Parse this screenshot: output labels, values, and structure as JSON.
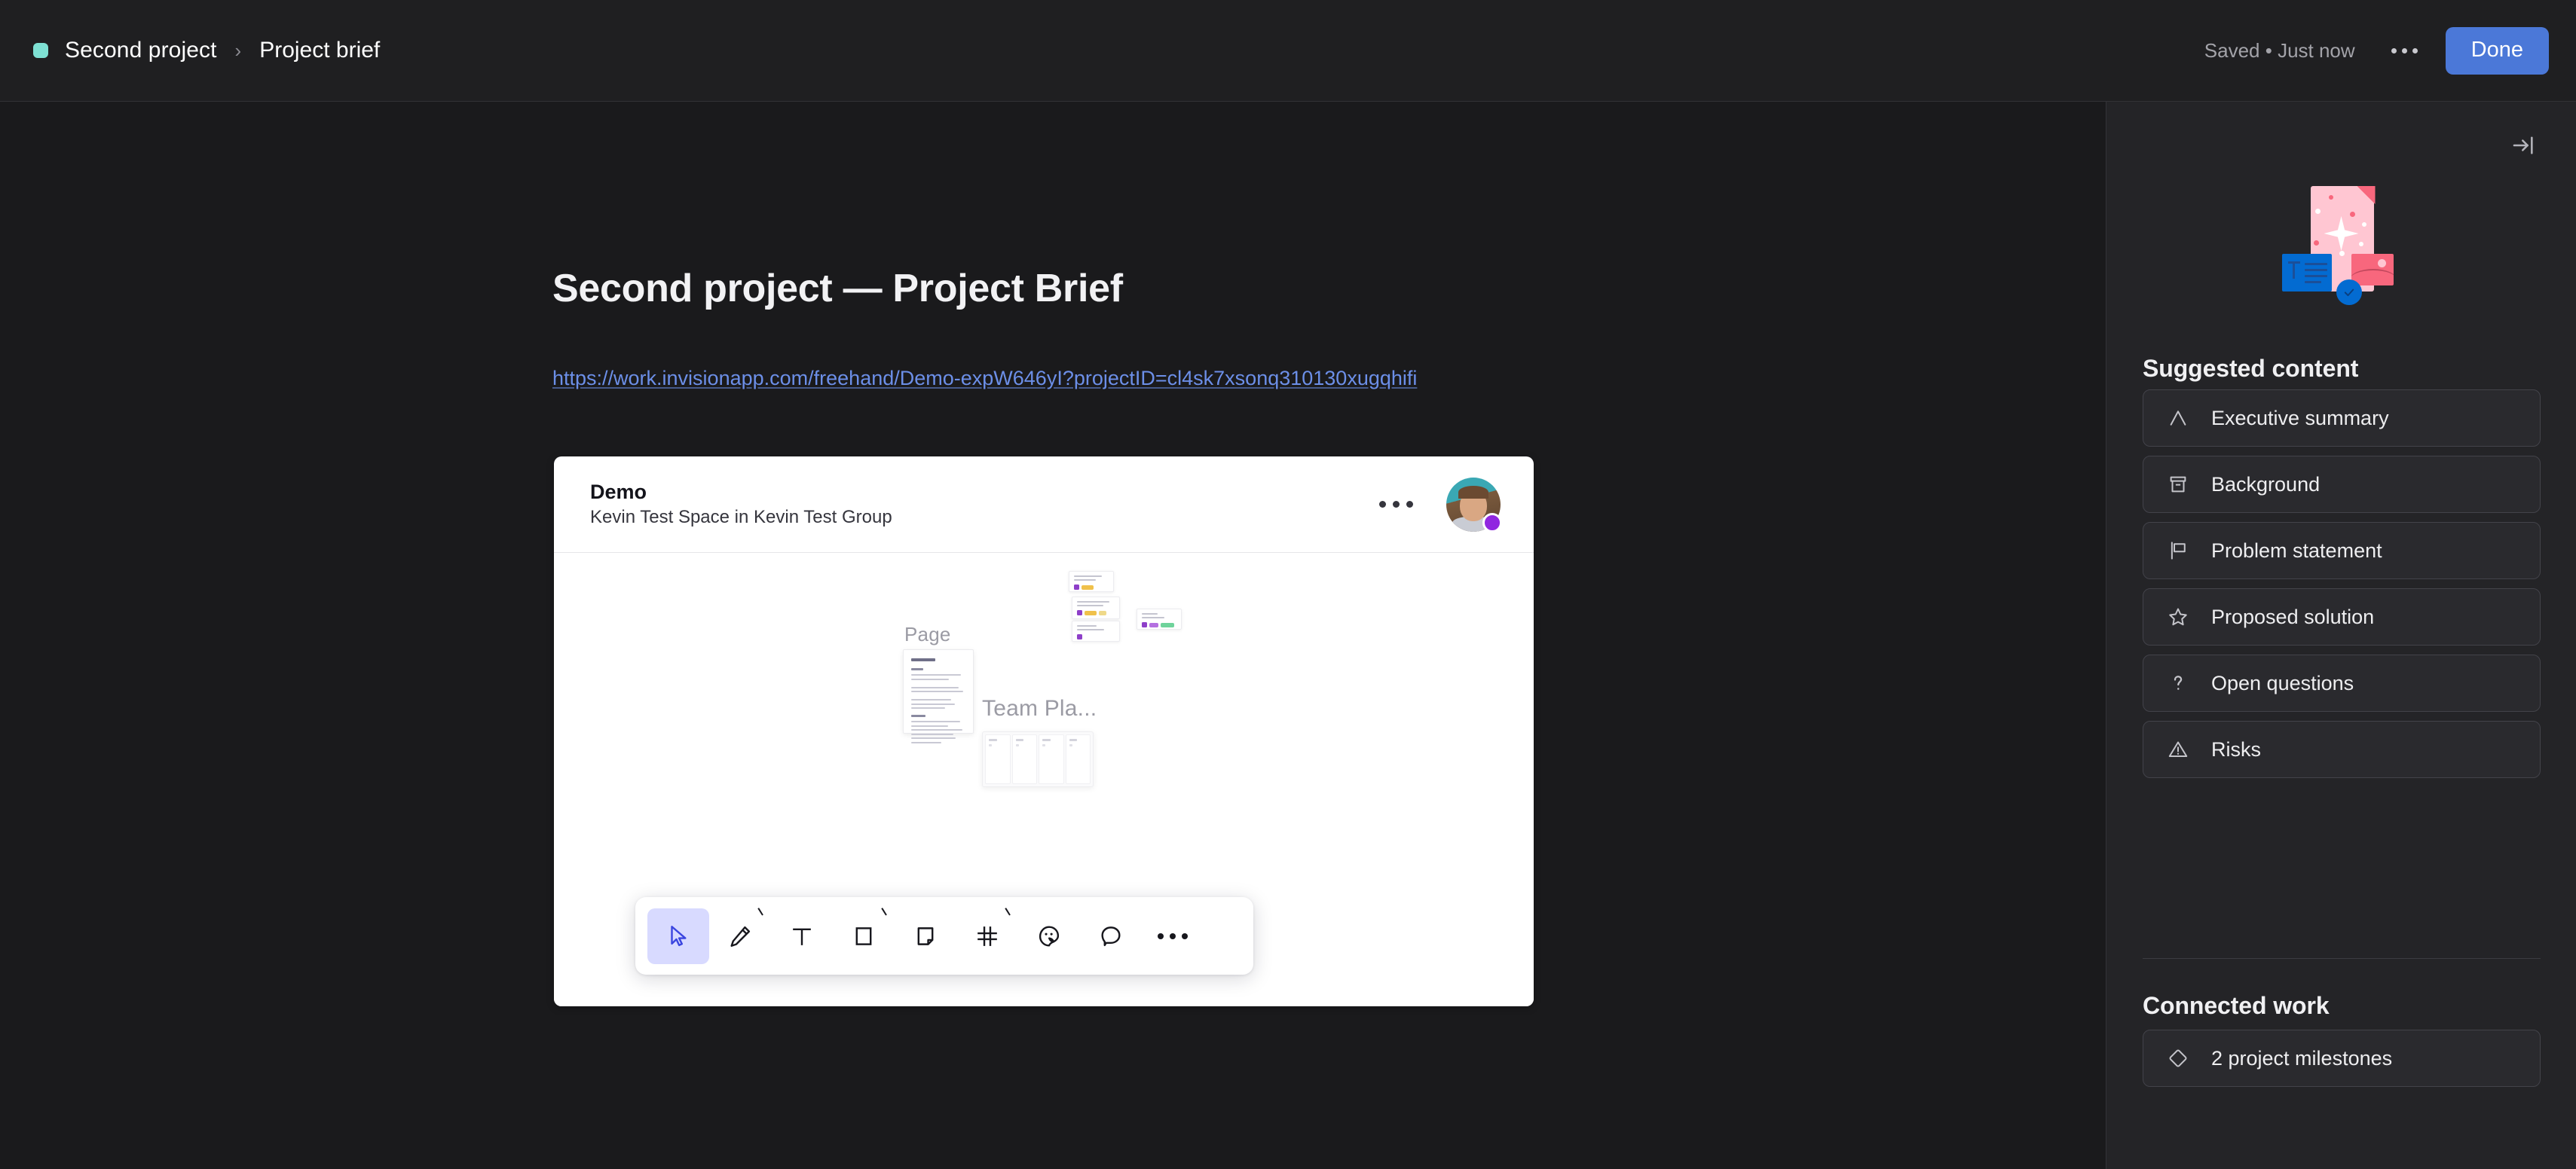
{
  "header": {
    "project_dot_color": "#7ee0d3",
    "breadcrumb_project": "Second project",
    "breadcrumb_separator": "›",
    "breadcrumb_current": "Project brief",
    "save_status": "Saved • Just now",
    "more_icon": "more-horizontal-icon",
    "done_label": "Done",
    "done_color": "#4b78d8"
  },
  "document": {
    "title": "Second project — Project Brief",
    "url": "https://work.invisionapp.com/freehand/Demo-expW646yI?projectID=cl4sk7xsonq310130xugqhifi",
    "url_color": "#6c8fe8"
  },
  "embed": {
    "name": "Demo",
    "subtitle": "Kevin Test Space in Kevin Test Group",
    "more_icon": "more-horizontal-icon",
    "avatar_icon": "avatar",
    "avatar_badge_color": "#9027e0",
    "canvas": {
      "page_label": "Page",
      "team_label": "Team Pla..."
    },
    "toolbar": {
      "tools": [
        {
          "name": "select-tool",
          "icon": "cursor-icon",
          "active": true,
          "caret": false
        },
        {
          "name": "pen-tool",
          "icon": "pencil-icon",
          "active": false,
          "caret": true
        },
        {
          "name": "text-tool",
          "icon": "text-icon",
          "active": false,
          "caret": false
        },
        {
          "name": "shape-tool",
          "icon": "square-icon",
          "active": false,
          "caret": true
        },
        {
          "name": "sticky-tool",
          "icon": "sticky-note-icon",
          "active": false,
          "caret": false
        },
        {
          "name": "frame-tool",
          "icon": "grid-icon",
          "active": false,
          "caret": true
        },
        {
          "name": "sticker-tool",
          "icon": "sticker-icon",
          "active": false,
          "caret": false
        },
        {
          "name": "comment-tool",
          "icon": "comment-icon",
          "active": false,
          "caret": false
        },
        {
          "name": "more-tools",
          "icon": "more-horizontal-icon",
          "active": false,
          "caret": false
        }
      ],
      "active_color": "#d8daff",
      "active_icon_color": "#3b46e0"
    }
  },
  "sidebar": {
    "collapse_icon": "arrow-to-line-right-icon",
    "illustration_icon": "sparkle-document-illustration",
    "suggested_title": "Suggested content",
    "suggested_items": [
      {
        "label": "Executive summary",
        "icon": "peak-icon"
      },
      {
        "label": "Background",
        "icon": "archive-icon"
      },
      {
        "label": "Problem statement",
        "icon": "flag-icon"
      },
      {
        "label": "Proposed solution",
        "icon": "star-icon"
      },
      {
        "label": "Open questions",
        "icon": "question-mark-icon"
      },
      {
        "label": "Risks",
        "icon": "warning-triangle-icon"
      }
    ],
    "connected_title": "Connected work",
    "connected_items": [
      {
        "label": "2 project milestones",
        "icon": "diamond-icon"
      }
    ]
  }
}
